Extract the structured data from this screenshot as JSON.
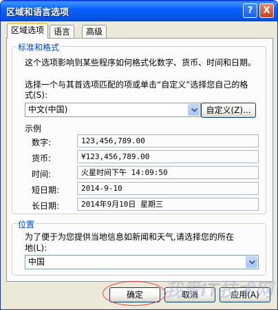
{
  "window": {
    "title": "区域和语言选项",
    "help_button": "?",
    "close_button": "X"
  },
  "tabs": [
    {
      "label": "区域选项",
      "active": true
    },
    {
      "label": "语言",
      "active": false
    },
    {
      "label": "高级",
      "active": false
    }
  ],
  "standards": {
    "group_title": "标准和格式",
    "description": "这个选项影响到某些程序如何格式化数字、货币、时间和日期。",
    "select_prompt_line1": "选择一个与其首选项匹配的项或单击“自定义”选择您自己的格",
    "select_prompt_line2": "式(S):",
    "selected_format": "中文(中国)",
    "customize_button": "自定义(Z)...",
    "samples_heading": "示例",
    "samples": [
      {
        "label": "数字:",
        "value": "123,456,789.00"
      },
      {
        "label": "货币:",
        "value": "¥123,456,789.00"
      },
      {
        "label": "时间:",
        "value": "火星时间下午 14:09:50"
      },
      {
        "label": "短日期:",
        "value": "2014-9-10"
      },
      {
        "label": "长日期:",
        "value": "2014年9月10日 星期三"
      }
    ]
  },
  "location": {
    "group_title": "位置",
    "description_line1": "为了便于为您提供当地信息如新闻和天气,请选择您的所在",
    "description_line2": "地(L):",
    "selected_location": "中国"
  },
  "footer": {
    "ok_button": "确定",
    "cancel_button": "取消",
    "apply_button": "应用(A)"
  },
  "watermark_text": "我爱IT技术网",
  "colors": {
    "titlebar": "#0553e3",
    "group_title": "#0046d5",
    "highlight_oval": "#e23c3c"
  }
}
